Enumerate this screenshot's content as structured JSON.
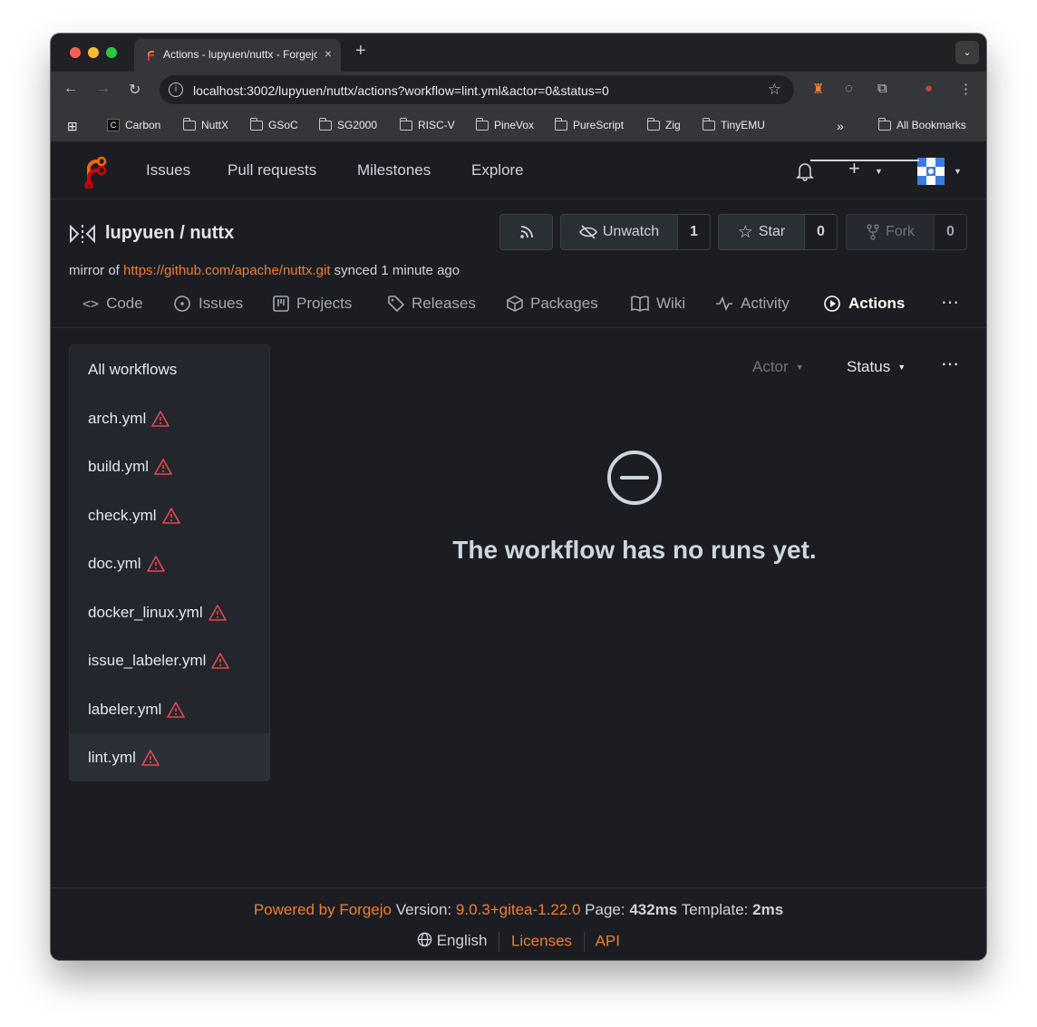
{
  "browser": {
    "tab_title": "Actions - lupyuen/nuttx - Forgejo",
    "new_tab": "+",
    "tab_close": "×",
    "url": "localhost:3002/lupyuen/nuttx/actions?workflow=lint.yml&actor=0&status=0",
    "bookmarks": [
      "Carbon",
      "NuttX",
      "GSoC",
      "SG2000",
      "RISC-V",
      "PineVox",
      "PureScript",
      "Zig",
      "TinyEMU"
    ],
    "bookmarks_overflow": "»",
    "all_bookmarks": "All Bookmarks"
  },
  "nav": {
    "links": [
      "Issues",
      "Pull requests",
      "Milestones",
      "Explore"
    ]
  },
  "repo": {
    "owner": "lupyuen",
    "name": "nuttx",
    "title": "lupyuen / nuttx",
    "unwatch_label": "Unwatch",
    "watch_count": "1",
    "star_label": "Star",
    "star_count": "0",
    "fork_label": "Fork",
    "fork_count": "0",
    "mirror_prefix": "mirror of",
    "mirror_url": "https://github.com/apache/nuttx.git",
    "mirror_suffix": "synced 1 minute ago",
    "tabs": [
      "Code",
      "Issues",
      "Projects",
      "Releases",
      "Packages",
      "Wiki",
      "Activity",
      "Actions"
    ],
    "active_tab": "Actions"
  },
  "sidebar": {
    "items": [
      {
        "label": "All workflows",
        "warning": false
      },
      {
        "label": "arch.yml",
        "warning": true
      },
      {
        "label": "build.yml",
        "warning": true
      },
      {
        "label": "check.yml",
        "warning": true
      },
      {
        "label": "doc.yml",
        "warning": true
      },
      {
        "label": "docker_linux.yml",
        "warning": true
      },
      {
        "label": "issue_labeler.yml",
        "warning": true
      },
      {
        "label": "labeler.yml",
        "warning": true
      },
      {
        "label": "lint.yml",
        "warning": true
      }
    ],
    "selected": "lint.yml"
  },
  "filters": {
    "actor_label": "Actor",
    "status_label": "Status"
  },
  "empty_state": {
    "message": "The workflow has no runs yet."
  },
  "footer": {
    "powered_by": "Powered by Forgejo",
    "version_label": "Version:",
    "version": "9.0.3+gitea-1.22.0",
    "page_label": "Page:",
    "page_time": "432ms",
    "template_label": "Template:",
    "template_time": "2ms",
    "language": "English",
    "licenses": "Licenses",
    "api": "API"
  },
  "colors": {
    "accent": "#ee7f34",
    "warning": "#e5484d",
    "background": "#1b1d22"
  }
}
